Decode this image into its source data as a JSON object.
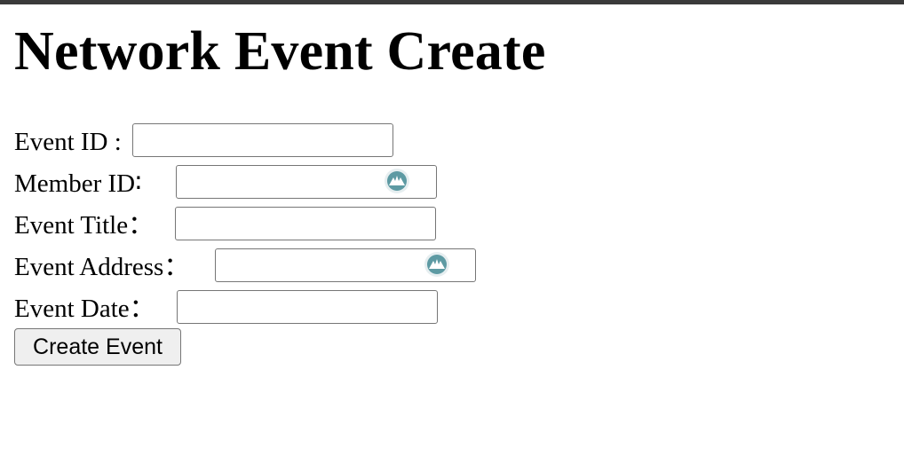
{
  "page_title": "Network Event Create",
  "form": {
    "fields": [
      {
        "label": "Event ID :",
        "value": "",
        "icon": null
      },
      {
        "label": "Member ID∶",
        "value": "",
        "icon": "password-manager-icon"
      },
      {
        "label": "Event Title：",
        "value": "",
        "icon": null
      },
      {
        "label": "Event Address：",
        "value": "",
        "icon": "password-manager-icon"
      },
      {
        "label": "Event Date：",
        "value": "",
        "icon": null
      }
    ],
    "submit_label": "Create Event"
  },
  "colors": {
    "top_bar": "#3a3a3a",
    "field_border": "#767676",
    "button_bg": "#efefef",
    "icon_teal": "#5d9aa3"
  }
}
